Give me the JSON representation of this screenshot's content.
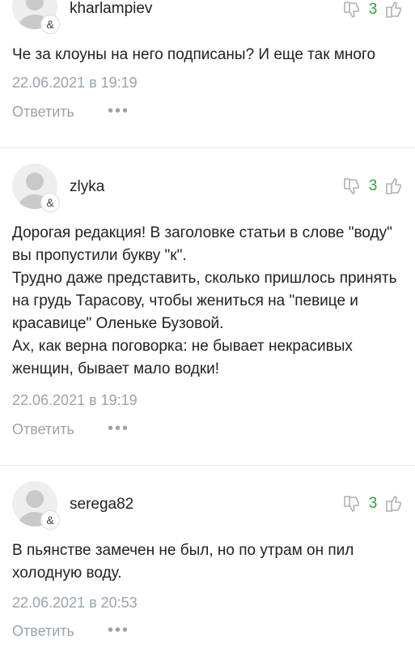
{
  "reply_label": "Ответить",
  "more_label": "•••",
  "vote_color": "#2aa53a",
  "comments": [
    {
      "username": "kharlampiev",
      "votes": "3",
      "text": "Че за клоуны на него подписаны? И еще так много",
      "date": "22.06.2021 в 19:19"
    },
    {
      "username": "zlyka",
      "votes": "3",
      "text": "Дорогая редакция! В заголовке статьи в слове \"воду\" вы пропустили букву \"к\".\nТрудно даже представить, сколько пришлось принять на грудь Тарасову, чтобы жениться на \"певице и красавице\" Оленьке Бузовой.\nАх, как верна поговорка: не бывает некрасивых женщин, бывает мало водки!",
      "date": "22.06.2021 в 19:19"
    },
    {
      "username": "serega82",
      "votes": "3",
      "text": "В пьянстве замечен не был, но по утрам он пил холодную воду.",
      "date": "22.06.2021 в 20:53"
    }
  ]
}
